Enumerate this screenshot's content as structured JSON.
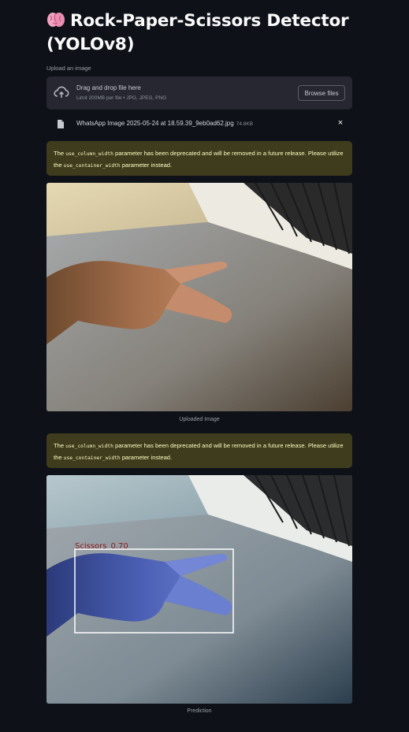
{
  "title": "Rock-Paper-Scissors Detector (YOLOv8)",
  "icons": {
    "title": "brain-icon",
    "upload": "cloud-upload-icon",
    "file": "file-icon",
    "remove": "close-icon"
  },
  "uploader": {
    "label": "Upload an image",
    "drop_text": "Drag and drop file here",
    "limit_text": "Limit 200MB per file • JPG, JPEG, PNG",
    "browse_label": "Browse files"
  },
  "file": {
    "name": "WhatsApp Image 2025-05-24 at 18.59.39_9eb0ad62.jpg",
    "size": "74.8KB",
    "remove": "×"
  },
  "warning": {
    "pre": "The ",
    "param_old": "use_column_width",
    "mid": " parameter has been deprecated and will be removed in a future release. Please utilize the ",
    "param_new": "use_container_width",
    "post": " parameter instead."
  },
  "uploaded_caption": "Uploaded Image",
  "prediction_caption": "Prediction",
  "detection": {
    "label": "Scissors",
    "confidence": "0.70"
  },
  "colors": {
    "background": "#0e1117",
    "dropzone": "#262730",
    "warning_bg": "#3e3c1d",
    "warning_text": "#ffffc2",
    "bbox": "#ffffff",
    "bbox_label": "#8b1a1a"
  }
}
